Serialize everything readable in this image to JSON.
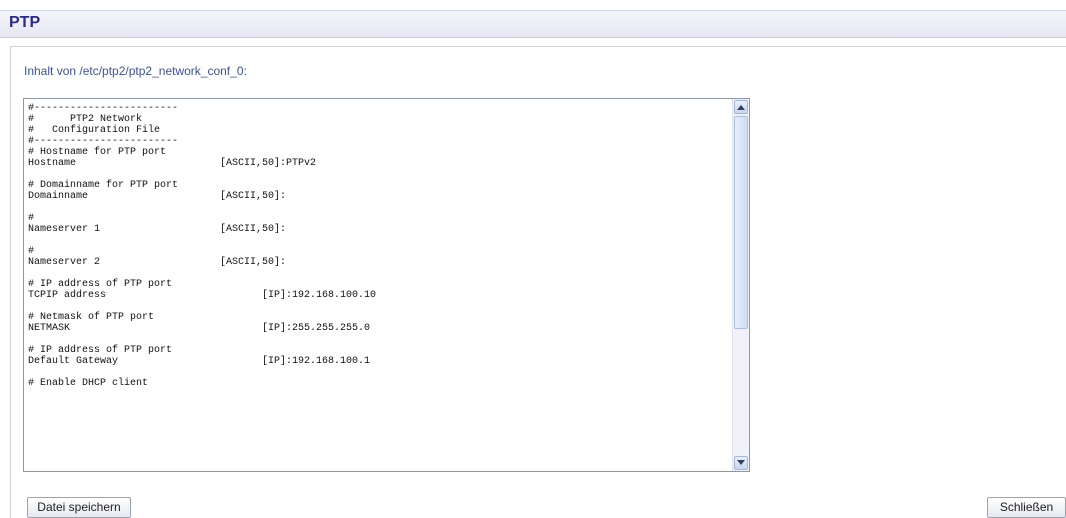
{
  "header": {
    "title": "PTP"
  },
  "content": {
    "path_label": "Inhalt von /etc/ptp2/ptp2_network_conf_0:",
    "lines": [
      "#------------------------",
      "#      PTP2 Network",
      "#   Configuration File",
      "#------------------------",
      "# Hostname for PTP port",
      "Hostname                        [ASCII,50]:PTPv2",
      "",
      "# Domainname for PTP port",
      "Domainname                      [ASCII,50]:",
      "",
      "#",
      "Nameserver 1                    [ASCII,50]:",
      "",
      "#",
      "Nameserver 2                    [ASCII,50]:",
      "",
      "# IP address of PTP port",
      "TCPIP address                          [IP]:192.168.100.10",
      "",
      "# Netmask of PTP port",
      "NETMASK                                [IP]:255.255.255.0",
      "",
      "# IP address of PTP port",
      "Default Gateway                        [IP]:192.168.100.1",
      "",
      "# Enable DHCP client"
    ]
  },
  "buttons": {
    "save_label": "Datei speichern",
    "close_label": "Schließen"
  }
}
